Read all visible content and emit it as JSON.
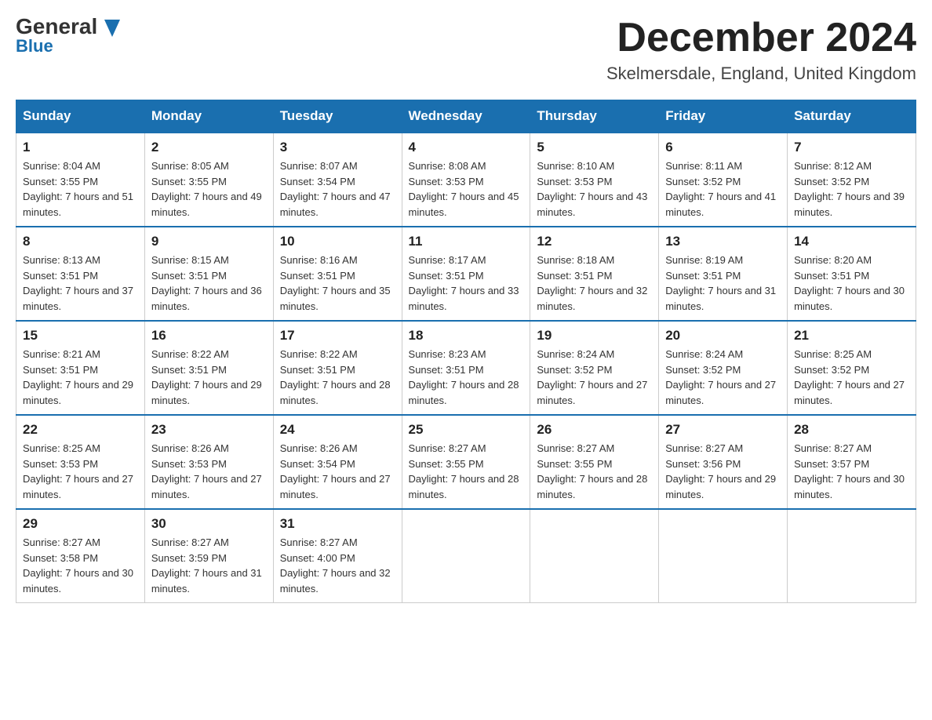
{
  "header": {
    "logo_line1": "General",
    "logo_line2": "Blue",
    "month_title": "December 2024",
    "location": "Skelmersdale, England, United Kingdom"
  },
  "weekdays": [
    "Sunday",
    "Monday",
    "Tuesday",
    "Wednesday",
    "Thursday",
    "Friday",
    "Saturday"
  ],
  "weeks": [
    [
      {
        "day": "1",
        "sunrise": "8:04 AM",
        "sunset": "3:55 PM",
        "daylight": "7 hours and 51 minutes."
      },
      {
        "day": "2",
        "sunrise": "8:05 AM",
        "sunset": "3:55 PM",
        "daylight": "7 hours and 49 minutes."
      },
      {
        "day": "3",
        "sunrise": "8:07 AM",
        "sunset": "3:54 PM",
        "daylight": "7 hours and 47 minutes."
      },
      {
        "day": "4",
        "sunrise": "8:08 AM",
        "sunset": "3:53 PM",
        "daylight": "7 hours and 45 minutes."
      },
      {
        "day": "5",
        "sunrise": "8:10 AM",
        "sunset": "3:53 PM",
        "daylight": "7 hours and 43 minutes."
      },
      {
        "day": "6",
        "sunrise": "8:11 AM",
        "sunset": "3:52 PM",
        "daylight": "7 hours and 41 minutes."
      },
      {
        "day": "7",
        "sunrise": "8:12 AM",
        "sunset": "3:52 PM",
        "daylight": "7 hours and 39 minutes."
      }
    ],
    [
      {
        "day": "8",
        "sunrise": "8:13 AM",
        "sunset": "3:51 PM",
        "daylight": "7 hours and 37 minutes."
      },
      {
        "day": "9",
        "sunrise": "8:15 AM",
        "sunset": "3:51 PM",
        "daylight": "7 hours and 36 minutes."
      },
      {
        "day": "10",
        "sunrise": "8:16 AM",
        "sunset": "3:51 PM",
        "daylight": "7 hours and 35 minutes."
      },
      {
        "day": "11",
        "sunrise": "8:17 AM",
        "sunset": "3:51 PM",
        "daylight": "7 hours and 33 minutes."
      },
      {
        "day": "12",
        "sunrise": "8:18 AM",
        "sunset": "3:51 PM",
        "daylight": "7 hours and 32 minutes."
      },
      {
        "day": "13",
        "sunrise": "8:19 AM",
        "sunset": "3:51 PM",
        "daylight": "7 hours and 31 minutes."
      },
      {
        "day": "14",
        "sunrise": "8:20 AM",
        "sunset": "3:51 PM",
        "daylight": "7 hours and 30 minutes."
      }
    ],
    [
      {
        "day": "15",
        "sunrise": "8:21 AM",
        "sunset": "3:51 PM",
        "daylight": "7 hours and 29 minutes."
      },
      {
        "day": "16",
        "sunrise": "8:22 AM",
        "sunset": "3:51 PM",
        "daylight": "7 hours and 29 minutes."
      },
      {
        "day": "17",
        "sunrise": "8:22 AM",
        "sunset": "3:51 PM",
        "daylight": "7 hours and 28 minutes."
      },
      {
        "day": "18",
        "sunrise": "8:23 AM",
        "sunset": "3:51 PM",
        "daylight": "7 hours and 28 minutes."
      },
      {
        "day": "19",
        "sunrise": "8:24 AM",
        "sunset": "3:52 PM",
        "daylight": "7 hours and 27 minutes."
      },
      {
        "day": "20",
        "sunrise": "8:24 AM",
        "sunset": "3:52 PM",
        "daylight": "7 hours and 27 minutes."
      },
      {
        "day": "21",
        "sunrise": "8:25 AM",
        "sunset": "3:52 PM",
        "daylight": "7 hours and 27 minutes."
      }
    ],
    [
      {
        "day": "22",
        "sunrise": "8:25 AM",
        "sunset": "3:53 PM",
        "daylight": "7 hours and 27 minutes."
      },
      {
        "day": "23",
        "sunrise": "8:26 AM",
        "sunset": "3:53 PM",
        "daylight": "7 hours and 27 minutes."
      },
      {
        "day": "24",
        "sunrise": "8:26 AM",
        "sunset": "3:54 PM",
        "daylight": "7 hours and 27 minutes."
      },
      {
        "day": "25",
        "sunrise": "8:27 AM",
        "sunset": "3:55 PM",
        "daylight": "7 hours and 28 minutes."
      },
      {
        "day": "26",
        "sunrise": "8:27 AM",
        "sunset": "3:55 PM",
        "daylight": "7 hours and 28 minutes."
      },
      {
        "day": "27",
        "sunrise": "8:27 AM",
        "sunset": "3:56 PM",
        "daylight": "7 hours and 29 minutes."
      },
      {
        "day": "28",
        "sunrise": "8:27 AM",
        "sunset": "3:57 PM",
        "daylight": "7 hours and 30 minutes."
      }
    ],
    [
      {
        "day": "29",
        "sunrise": "8:27 AM",
        "sunset": "3:58 PM",
        "daylight": "7 hours and 30 minutes."
      },
      {
        "day": "30",
        "sunrise": "8:27 AM",
        "sunset": "3:59 PM",
        "daylight": "7 hours and 31 minutes."
      },
      {
        "day": "31",
        "sunrise": "8:27 AM",
        "sunset": "4:00 PM",
        "daylight": "7 hours and 32 minutes."
      },
      null,
      null,
      null,
      null
    ]
  ]
}
